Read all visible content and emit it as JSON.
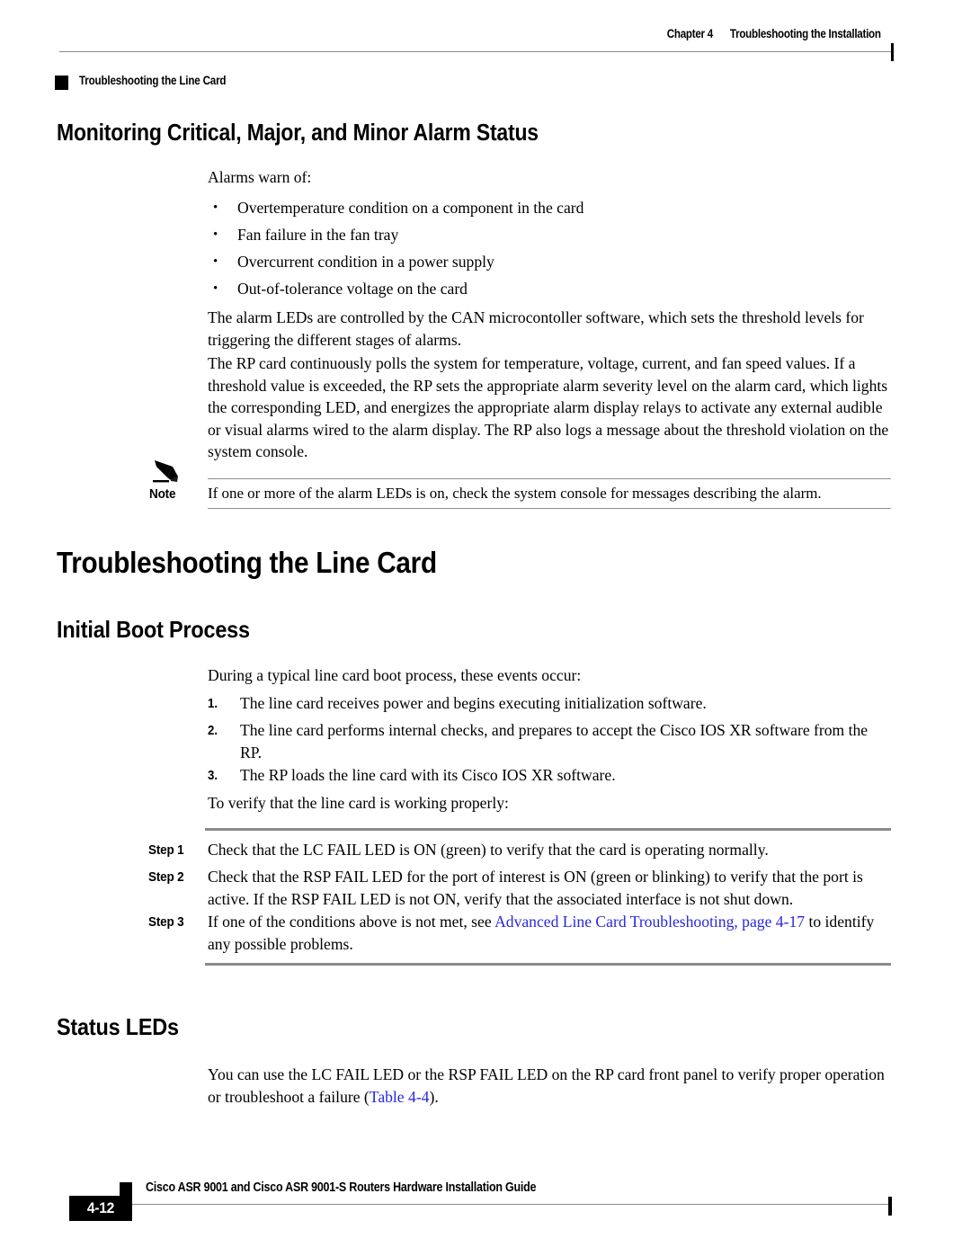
{
  "header": {
    "chapter_label": "Chapter 4",
    "chapter_title": "Troubleshooting the Installation",
    "running_head": "Troubleshooting the Line Card"
  },
  "sections": {
    "alarm_heading": "Monitoring Critical, Major, and Minor Alarm Status",
    "alarm_intro": "Alarms warn of:",
    "alarm_bullets": [
      "Overtemperature condition on a component in the card",
      "Fan failure in the fan tray",
      "Overcurrent condition in a power supply",
      "Out-of-tolerance voltage on the card"
    ],
    "alarm_para1": "The alarm LEDs are controlled by the CAN microcontoller software, which sets the threshold levels for triggering the different stages of alarms.",
    "alarm_para2": "The RP card continuously polls the system for temperature, voltage, current, and fan speed values. If a threshold value is exceeded, the RP sets the appropriate alarm severity level on the alarm card, which lights the corresponding LED, and energizes the appropriate alarm display relays to activate any external audible or visual alarms wired to the alarm display. The RP also logs a message about the threshold violation on the system console.",
    "note_label": "Note",
    "note_text": "If one or more of the alarm LEDs is on, check the system console for messages describing the alarm.",
    "line_card_heading": "Troubleshooting the Line Card",
    "initial_boot_heading": "Initial Boot Process",
    "boot_intro": "During a typical line card boot process, these events occur:",
    "boot_steps": [
      {
        "num": "1.",
        "text": "The line card receives power and begins executing initialization software."
      },
      {
        "num": "2.",
        "text": "The line card performs internal checks, and prepares to accept the Cisco IOS XR software from the RP."
      },
      {
        "num": "3.",
        "text": "The RP loads the line card with its Cisco IOS XR software."
      }
    ],
    "verify_intro": "To verify that the line card is working properly:",
    "procedure_steps": [
      {
        "label": "Step 1",
        "text_before": "Check that the LC FAIL LED is ON (green) to verify that the card is operating normally.",
        "link": "",
        "text_after": ""
      },
      {
        "label": "Step 2",
        "text_before": "Check that the RSP FAIL LED for the port of interest is ON (green or blinking) to verify that the port is active. If the RSP FAIL LED is not ON, verify that the associated interface is not shut down.",
        "link": "",
        "text_after": ""
      },
      {
        "label": "Step 3",
        "text_before": "If one of the conditions above is not met, see ",
        "link": "Advanced Line Card Troubleshooting, page 4-17",
        "text_after": " to identify any possible problems."
      }
    ],
    "status_leds_heading": "Status LEDs",
    "status_leds_para_before": "You can use the LC FAIL LED or the RSP FAIL LED on the RP card front panel to verify proper operation or troubleshoot a failure (",
    "status_leds_link": "Table 4-4",
    "status_leds_para_after": ")."
  },
  "footer": {
    "page_number": "4-12",
    "guide_title": "Cisco ASR 9001 and Cisco ASR 9001-S Routers Hardware Installation Guide"
  },
  "colors": {
    "link": "#2727e0",
    "rule": "#8a8a8a",
    "text": "#000000"
  }
}
